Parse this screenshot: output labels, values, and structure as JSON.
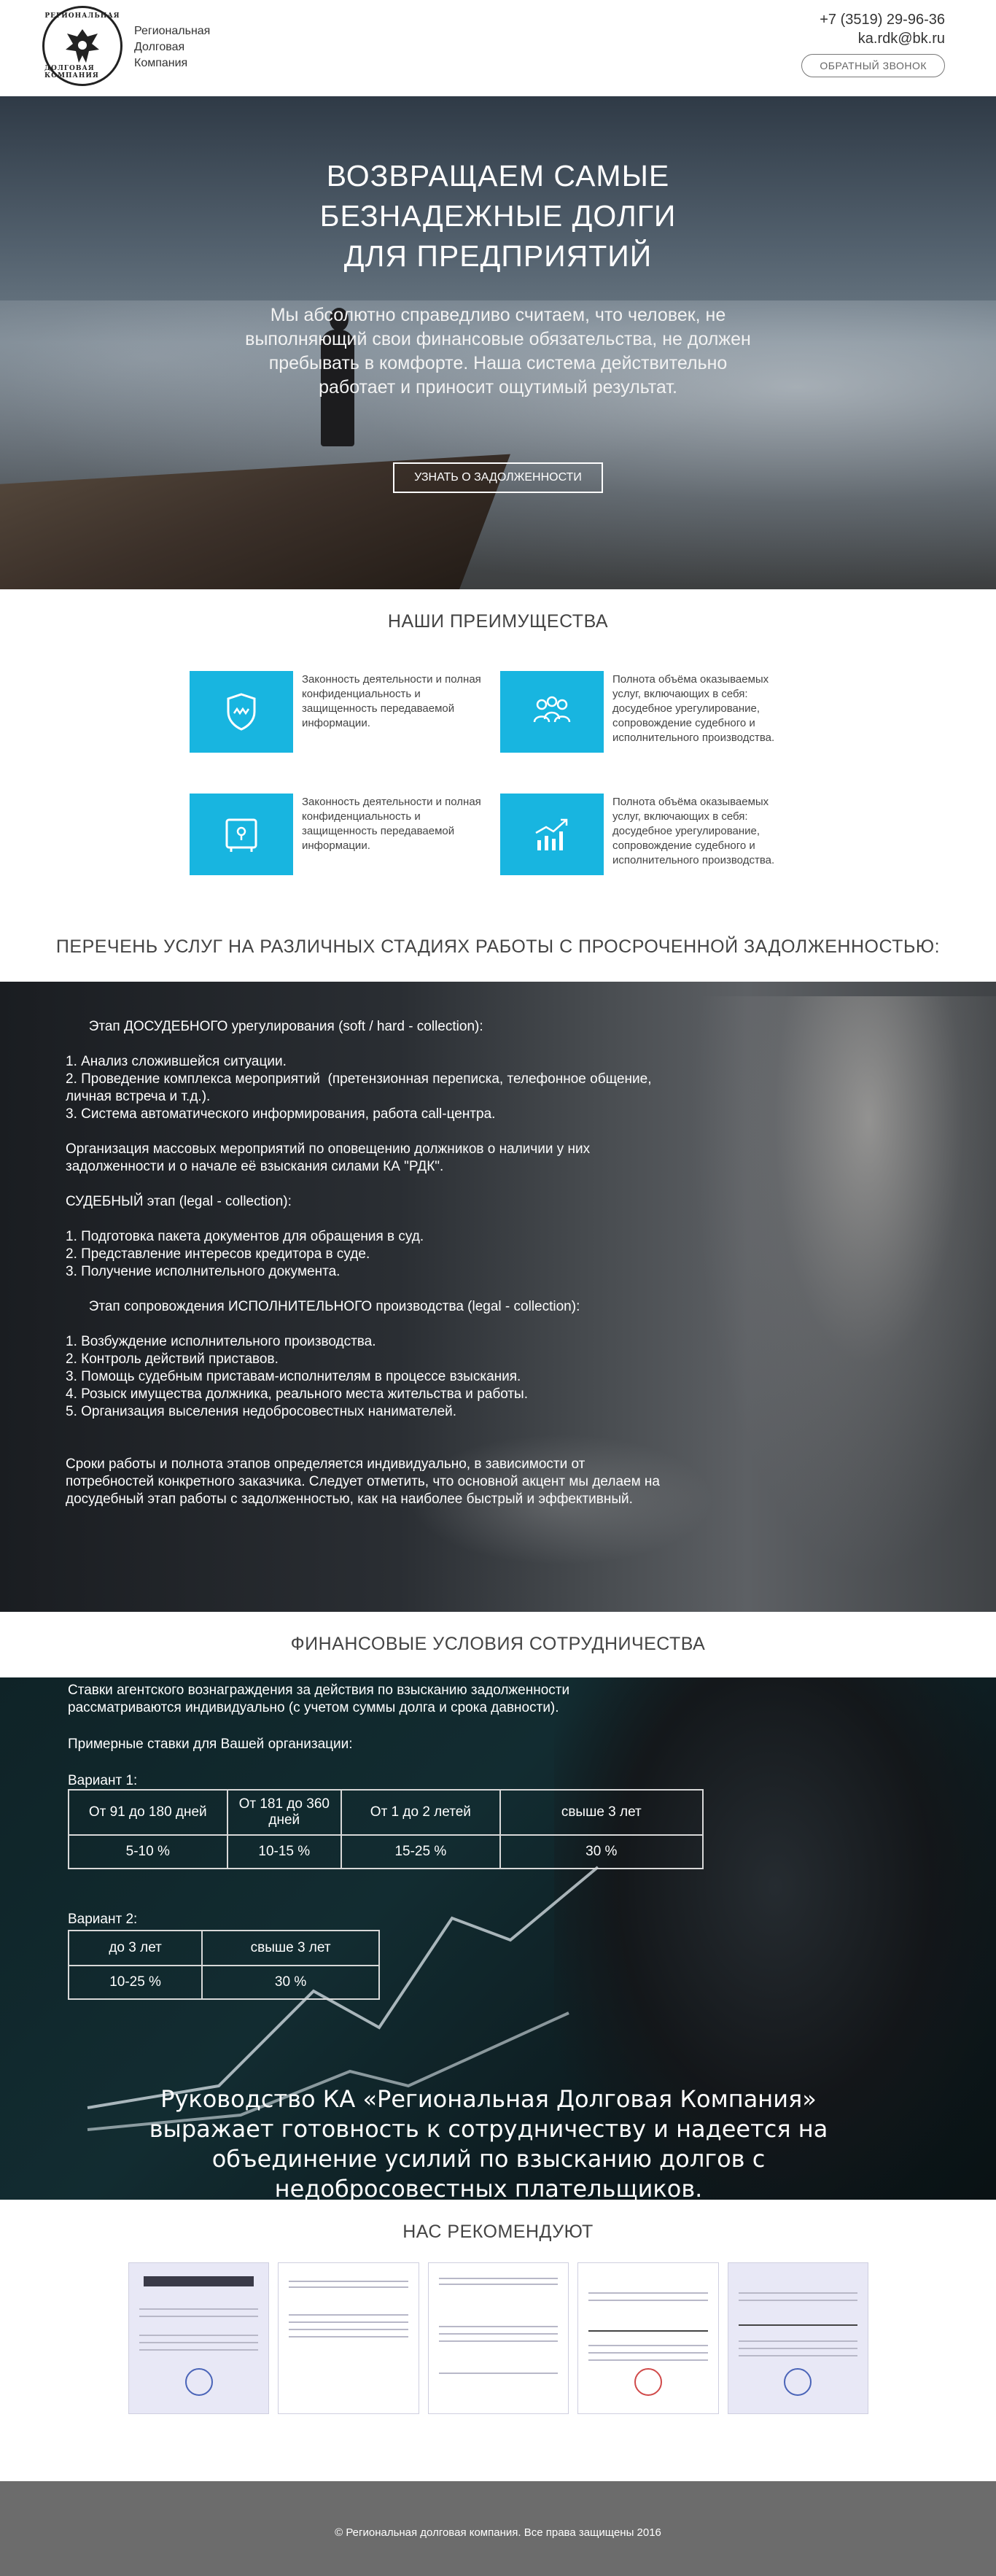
{
  "header": {
    "logo_text_top": "РЕГИОНАЛЬНАЯ",
    "logo_text_bottom": "ДОЛГОВАЯ КОМПАНИЯ",
    "brand": "Региональная Долговая Компания",
    "phone": "+7 (3519) 29-96-36",
    "email": "ka.rdk@bk.ru",
    "callback_label": "ОБРАТНЫЙ ЗВОНОК"
  },
  "hero": {
    "title": "ВОЗВРАЩАЕМ САМЫЕ БЕЗНАДЕЖНЫЕ ДОЛГИ ДЛЯ ПРЕДПРИЯТИЙ",
    "text": "Мы абсолютно справедливо считаем, что человек, не выполняющий свои финансовые обязательства, не должен пребывать в комфорте. Наша система действительно работает и приносит ощутимый результат.",
    "button_label": "УЗНАТЬ О ЗАДОЛЖЕННОСТИ"
  },
  "advantages": {
    "title": "НАШИ ПРЕИМУЩЕСТВА",
    "items": [
      {
        "icon": "shield-icon",
        "text": "Законность деятельности и полная конфиденциальность и защищенность передаваемой информации."
      },
      {
        "icon": "team-icon",
        "text": "Полнота объёма оказываемых услуг, включающих в себя: досудебное урегулирование, сопровождение судебного и исполнительного производства."
      },
      {
        "icon": "safe-icon",
        "text": "Законность деятельности и полная конфиденциальность и защищенность передаваемой информации."
      },
      {
        "icon": "growth-chart-icon",
        "text": "Полнота объёма оказываемых услуг, включающих в себя: досудебное урегулирование, сопровождение судебного и исполнительного производства."
      }
    ]
  },
  "services": {
    "title": "ПЕРЕЧЕНЬ УСЛУГ НА РАЗЛИЧНЫХ СТАДИЯХ РАБОТЫ С ПРОСРОЧЕННОЙ ЗАДОЛЖЕННОСТЬЮ:",
    "body": "      Этап ДОСУДЕБНОГО урегулирования (soft / hard - collection):\n\n1. Анализ сложившейся ситуации.\n2. Проведение комплекса мероприятий  (претензионная переписка, телефонное общение,\nличная встреча и т.д.).\n3. Система автоматического информирования, работа call-центра.\n\nОрганизация массовых мероприятий по оповещению должников о наличии у них\nзадолженности и о начале её взыскания силами КА \"РДК\".\n\nСУДЕБНЫЙ этап (legal - collection):\n\n1. Подготовка пакета документов для обращения в суд.\n2. Представление интересов кредитора в суде.\n3. Получение исполнительного документа.\n\n      Этап сопровождения ИСПОЛНИТЕЛЬНОГО производства (legal - collection):\n\n1. Возбуждение исполнительного производства.\n2. Контроль действий приставов.\n3. Помощь судебным приставам-исполнителям в процессе взыскания.\n4. Розыск имущества должника, реального места жительства и работы.\n5. Организация выселения недобросовестных нанимателей.\n\n\nСроки работы и полнота этапов определяется индивидуально, в зависимости от\nпотребностей конкретного заказчика. Следует отметить, что основной акцент мы делаем на\nдосудебный этап работы с задолженностью, как на наиболее быстрый и эффективный."
  },
  "finance": {
    "title": "ФИНАНСОВЫЕ УСЛОВИЯ СОТРУДНИЧЕСТВА",
    "intro": "Ставки агентского вознаграждения за действия по взысканию задолженности рассматриваются индивидуально (с учетом суммы долга и срока давности).",
    "sample_label": "Примерные ставки для Вашей организации:",
    "variant1": {
      "label": "Вариант 1:",
      "headers": [
        "От 91 до 180 дней",
        "От 181 до 360 дней",
        "От 1 до 2 летей",
        "свыше 3 лет"
      ],
      "values": [
        "5-10 %",
        "10-15 %",
        "15-25 %",
        "30 %"
      ]
    },
    "variant2": {
      "label": "Вариант 2:",
      "headers": [
        "до 3 лет",
        "свыше 3 лет"
      ],
      "values": [
        "10-25 %",
        "30 %"
      ]
    },
    "closing": "Руководство КА «Региональная Долговая Компания» выражает готовность к сотрудничеству и надеется на объединение усилий по взысканию долгов с недобросовестных плательщиков."
  },
  "recommend": {
    "title": "НАС РЕКОМЕНДУЮТ"
  },
  "footer": {
    "copyright": "© Региональная долговая компания. Все права защищены 2016"
  },
  "colors": {
    "accent": "#18b5e0",
    "footer": "#6c6c6c"
  }
}
